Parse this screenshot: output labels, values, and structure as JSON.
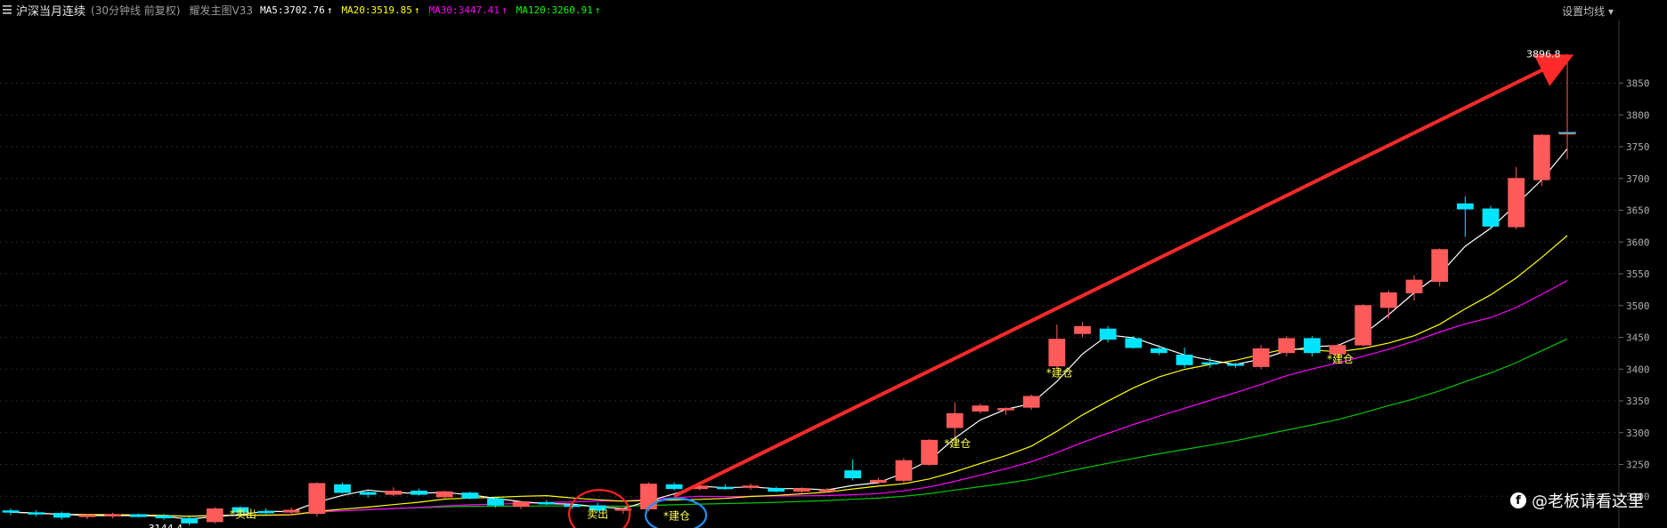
{
  "header": {
    "title": "沪深当月连续",
    "subtitle": "(30分钟线 前复权)",
    "indicator": "耀发主图V33",
    "ma": [
      {
        "label": "MA5:3702.76",
        "color": "#ffffff"
      },
      {
        "label": "MA20:3519.85",
        "color": "#ffff00"
      },
      {
        "label": "MA30:3447.41",
        "color": "#ff00ff"
      },
      {
        "label": "MA120:3260.91",
        "color": "#00ff00"
      }
    ],
    "settings_label": "设置均线"
  },
  "chart_data": {
    "type": "candlestick",
    "ylim": [
      3150,
      3950
    ],
    "yticks": [
      3200,
      3250,
      3300,
      3350,
      3400,
      3450,
      3500,
      3550,
      3600,
      3650,
      3700,
      3750,
      3800,
      3850
    ],
    "candles": [
      [
        3177,
        3181,
        3170,
        3175
      ],
      [
        3174,
        3178,
        3168,
        3172
      ],
      [
        3173,
        3176,
        3163,
        3167
      ],
      [
        3168,
        3172,
        3164,
        3170
      ],
      [
        3170,
        3174,
        3165,
        3171
      ],
      [
        3171,
        3173,
        3167,
        3168
      ],
      [
        3169,
        3172,
        3163,
        3166
      ],
      [
        3165,
        3168,
        3154,
        3158
      ],
      [
        3160,
        3183,
        3157,
        3180
      ],
      [
        3182,
        3184,
        3172,
        3175
      ],
      [
        3176,
        3181,
        3172,
        3174
      ],
      [
        3175,
        3182,
        3170,
        3178
      ],
      [
        3173,
        3222,
        3168,
        3220
      ],
      [
        3218,
        3222,
        3204,
        3206
      ],
      [
        3206,
        3208,
        3198,
        3203
      ],
      [
        3203,
        3214,
        3200,
        3208
      ],
      [
        3208,
        3212,
        3201,
        3203
      ],
      [
        3199,
        3209,
        3197,
        3207
      ],
      [
        3205,
        3207,
        3195,
        3197
      ],
      [
        3196,
        3200,
        3182,
        3186
      ],
      [
        3184,
        3192,
        3180,
        3191
      ],
      [
        3190,
        3194,
        3186,
        3188
      ],
      [
        3186,
        3189,
        3180,
        3184
      ],
      [
        3185,
        3190,
        3174,
        3178
      ],
      [
        3178,
        3182,
        3172,
        3180
      ],
      [
        3180,
        3222,
        3176,
        3219
      ],
      [
        3218,
        3222,
        3209,
        3212
      ],
      [
        3212,
        3218,
        3209,
        3216
      ],
      [
        3214,
        3219,
        3210,
        3212
      ],
      [
        3214,
        3220,
        3210,
        3216
      ],
      [
        3212,
        3215,
        3206,
        3208
      ],
      [
        3208,
        3214,
        3204,
        3212
      ],
      [
        3210,
        3213,
        3206,
        3210
      ],
      [
        3240,
        3258,
        3225,
        3229
      ],
      [
        3222,
        3229,
        3219,
        3225
      ],
      [
        3225,
        3260,
        3220,
        3256
      ],
      [
        3250,
        3290,
        3248,
        3288
      ],
      [
        3308,
        3348,
        3292,
        3330
      ],
      [
        3334,
        3346,
        3330,
        3342
      ],
      [
        3338,
        3340,
        3328,
        3338
      ],
      [
        3340,
        3360,
        3336,
        3357
      ],
      [
        3405,
        3470,
        3400,
        3447
      ],
      [
        3456,
        3474,
        3450,
        3467
      ],
      [
        3463,
        3468,
        3442,
        3447
      ],
      [
        3448,
        3452,
        3432,
        3434
      ],
      [
        3432,
        3438,
        3422,
        3426
      ],
      [
        3422,
        3434,
        3402,
        3407
      ],
      [
        3410,
        3418,
        3402,
        3409
      ],
      [
        3408,
        3410,
        3402,
        3406
      ],
      [
        3404,
        3438,
        3400,
        3432
      ],
      [
        3426,
        3452,
        3420,
        3448
      ],
      [
        3448,
        3452,
        3420,
        3426
      ],
      [
        3424,
        3440,
        3418,
        3437
      ],
      [
        3438,
        3502,
        3436,
        3500
      ],
      [
        3497,
        3524,
        3480,
        3520
      ],
      [
        3520,
        3548,
        3508,
        3540
      ],
      [
        3538,
        3590,
        3530,
        3588
      ],
      [
        3660,
        3672,
        3608,
        3652
      ],
      [
        3652,
        3657,
        3620,
        3625
      ],
      [
        3624,
        3718,
        3620,
        3700
      ],
      [
        3698,
        3770,
        3688,
        3768
      ],
      [
        3770,
        3896,
        3730,
        3772
      ]
    ],
    "labels": [
      {
        "text": "3144.4",
        "bar": 7,
        "price": 3150
      },
      {
        "text": "*卖出",
        "bar": 9,
        "price": 3172
      },
      {
        "text": "卖出",
        "bar": 23,
        "price": 3172
      },
      {
        "text": "*建仓",
        "bar": 26,
        "price": 3169
      },
      {
        "text": "*建仓",
        "bar": 37,
        "price": 3283
      },
      {
        "text": "*建仓",
        "bar": 41,
        "price": 3394
      },
      {
        "text": "*建仓",
        "bar": 52,
        "price": 3416
      },
      {
        "text": "3896.8",
        "bar": 61,
        "price": 3896
      }
    ]
  },
  "watermark": {
    "text": "@老板请看这里"
  }
}
